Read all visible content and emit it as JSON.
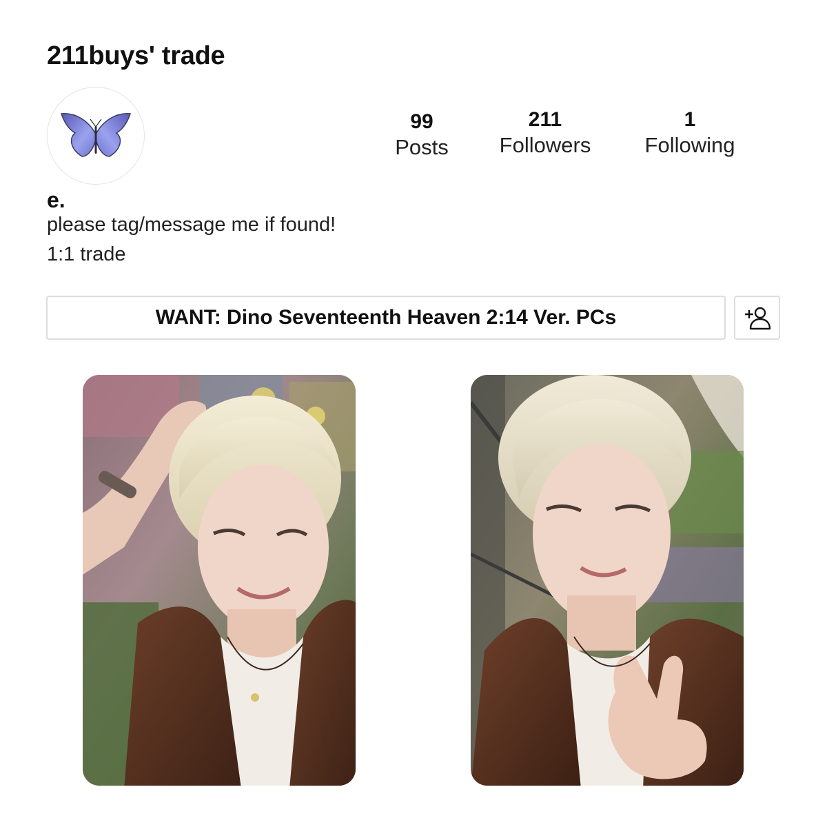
{
  "profile": {
    "title": "211buys' trade",
    "display_name": "e.",
    "bio": [
      "please tag/message me if found!",
      "1:1 trade"
    ],
    "avatar_icon": "butterfly-icon",
    "stats": {
      "posts": {
        "count": "99",
        "label": "Posts"
      },
      "followers": {
        "count": "211",
        "label": "Followers"
      },
      "following": {
        "count": "1",
        "label": "Following"
      }
    }
  },
  "want": {
    "label": "WANT: Dino Seventeenth Heaven 2:14 Ver. PCs"
  },
  "follow_button": {
    "icon": "add-person-icon"
  },
  "photocards": [
    {
      "icon": "photocard-image",
      "pose": "hand-on-head"
    },
    {
      "icon": "photocard-image",
      "pose": "peace-sign"
    }
  ],
  "colors": {
    "text": "#111111",
    "border": "#dcdcdc",
    "butterfly": "#8a90e0"
  }
}
